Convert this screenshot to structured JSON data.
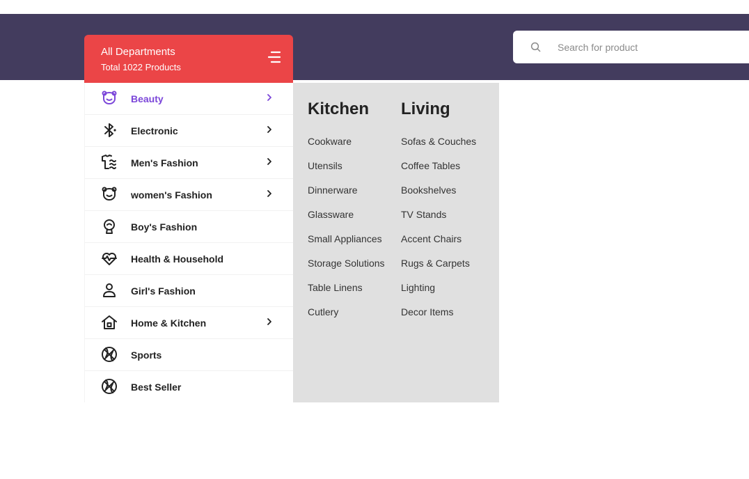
{
  "search": {
    "placeholder": "Search for product"
  },
  "departments": {
    "title": "All Departments",
    "subtitle": "Total 1022 Products",
    "items": [
      {
        "label": "Beauty",
        "icon": "bear-face-icon",
        "has_submenu": true,
        "active": true
      },
      {
        "label": "Electronic",
        "icon": "bluetooth-icon",
        "has_submenu": true
      },
      {
        "label": "Men's Fashion",
        "icon": "shirt-icon",
        "has_submenu": true
      },
      {
        "label": "women's Fashion",
        "icon": "bear-face-icon",
        "has_submenu": true
      },
      {
        "label": "Boy's Fashion",
        "icon": "boy-head-icon",
        "has_submenu": false
      },
      {
        "label": "Health & Household",
        "icon": "heartbeat-icon",
        "has_submenu": false
      },
      {
        "label": "Girl's Fashion",
        "icon": "person-icon",
        "has_submenu": false
      },
      {
        "label": "Home & Kitchen",
        "icon": "house-icon",
        "has_submenu": true
      },
      {
        "label": "Sports",
        "icon": "basketball-icon",
        "has_submenu": false
      },
      {
        "label": "Best Seller",
        "icon": "basketball-icon",
        "has_submenu": false
      }
    ]
  },
  "megamenu": {
    "columns": [
      {
        "heading": "Kitchen",
        "links": [
          "Cookware",
          "Utensils",
          "Dinnerware",
          "Glassware",
          "Small Appliances",
          "Storage Solutions",
          "Table Linens",
          "Cutlery"
        ]
      },
      {
        "heading": "Living",
        "links": [
          "Sofas & Couches",
          "Coffee Tables",
          "Bookshelves",
          "TV Stands",
          "Accent Chairs",
          "Rugs & Carpets",
          "Lighting",
          "Decor Items"
        ]
      }
    ]
  },
  "colors": {
    "topbar": "#433c5e",
    "accent_red": "#eb4547",
    "active_purple": "#7b46d9",
    "megamenu_bg": "#e0e0e0"
  }
}
